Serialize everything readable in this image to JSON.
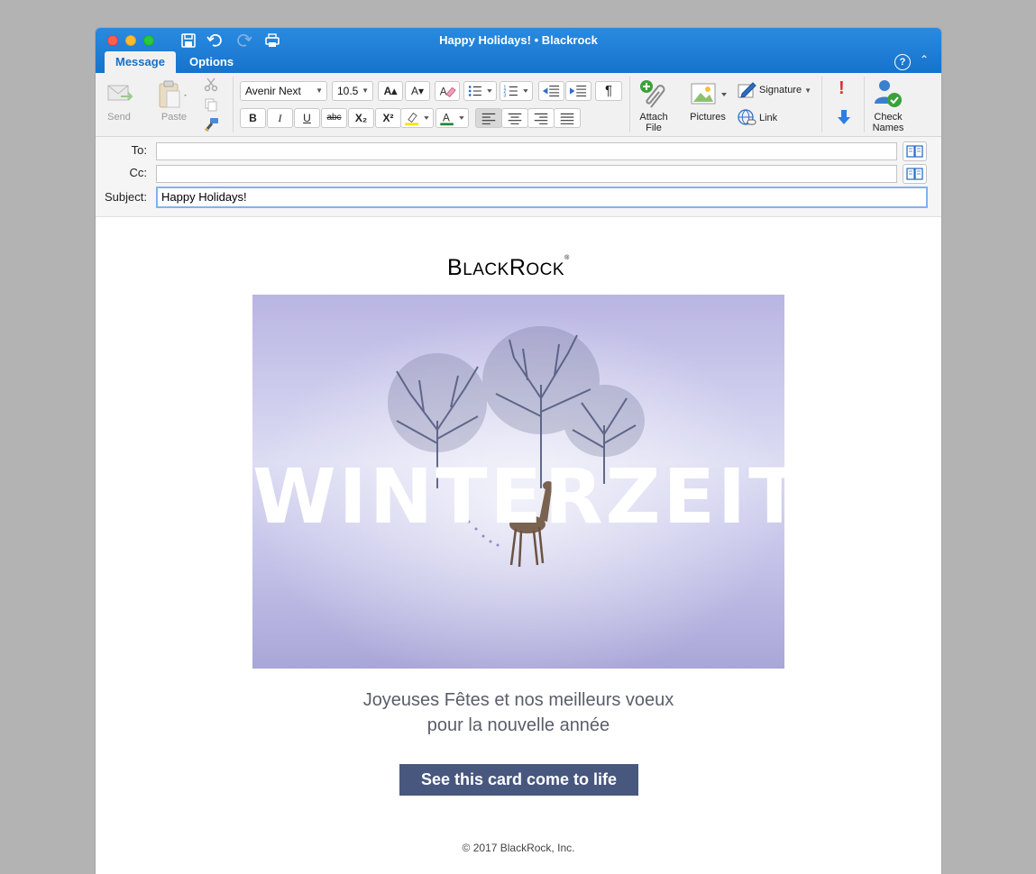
{
  "window": {
    "title": "Happy Holidays! • Blackrock",
    "tabs": [
      "Message",
      "Options"
    ],
    "help_icon": "?",
    "collapse_icon": "⌃"
  },
  "ribbon": {
    "send_label": "Send",
    "paste_label": "Paste",
    "font_name": "Avenir Next",
    "font_size": "10.5",
    "bold": "B",
    "italic": "I",
    "underline": "U",
    "strike": "abc",
    "subscript": "X₂",
    "superscript": "X²",
    "grow_font": "A▴",
    "shrink_font": "A▾",
    "paragraph_mark": "¶",
    "attach_label": "Attach\nFile",
    "attach_line1": "Attach",
    "attach_line2": "File",
    "pictures_label": "Pictures",
    "signature_label": "Signature",
    "link_label": "Link",
    "check_names_line1": "Check",
    "check_names_line2": "Names",
    "high_importance": "!",
    "low_importance": "↓"
  },
  "address": {
    "to_label": "To:",
    "cc_label": "Cc:",
    "subject_label": "Subject:",
    "to_value": "",
    "cc_value": "",
    "subject_value": "Happy Holidays!"
  },
  "email": {
    "logo_big1": "B",
    "logo_small1": "LACK",
    "logo_big2": "R",
    "logo_small2": "OCK",
    "logo_reg": "®",
    "hero_title": "WINTERZEIT",
    "greeting_line1": "Joyeuses Fêtes et nos meilleurs voeux",
    "greeting_line2": "pour la nouvelle année",
    "cta_label": "See this card come to life",
    "footer": "© 2017 BlackRock, Inc."
  },
  "colors": {
    "titlebar": "#1673cc",
    "cta_bg": "#48577e",
    "greeting_text": "#5a5e69"
  }
}
